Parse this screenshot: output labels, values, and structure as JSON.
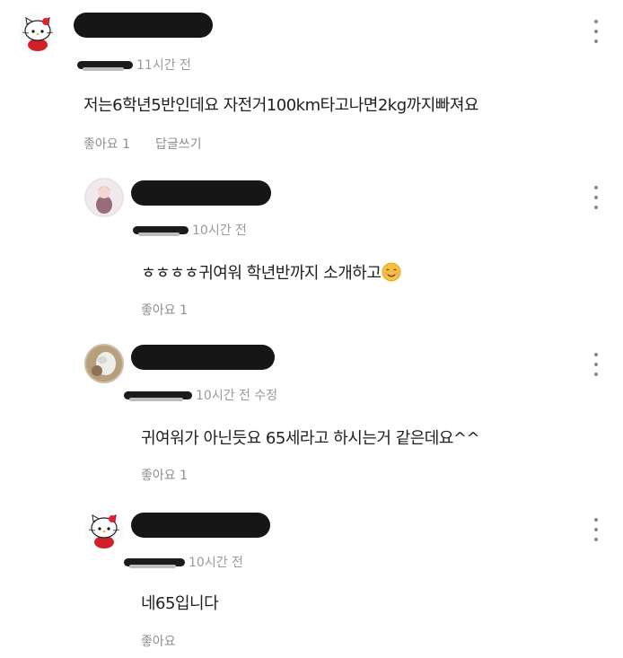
{
  "comments": [
    {
      "time": "11시간 전",
      "text": "저는6학년5반인데요 자전거100km타고나면2kg까지빠져요",
      "like_label": "좋아요 1",
      "reply_label": "답글쓰기",
      "avatar": "hello-kitty-avatar"
    },
    {
      "time": "10시간 전",
      "text": "ㅎㅎㅎㅎ귀여워 학년반까지 소개하고",
      "emoji": "smiling-face-emoji",
      "like_label": "좋아요 1",
      "avatar": "photo-avatar-figure"
    },
    {
      "time": "10시간 전 수정",
      "text": "귀여워가 아닌듯요 65세라고 하시는거 같은데요^^",
      "like_label": "좋아요 1",
      "avatar": "photo-avatar-animal"
    },
    {
      "time": "10시간 전",
      "text": "네65입니다",
      "like_label": "좋아요",
      "avatar": "hello-kitty-avatar"
    }
  ]
}
